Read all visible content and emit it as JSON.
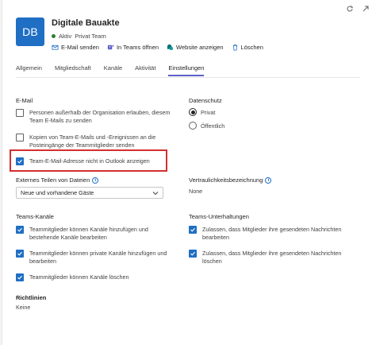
{
  "header": {
    "avatar_initials": "DB",
    "title": "Digitale Bauakte",
    "status": "Aktiv",
    "privacy": "Privat Team",
    "actions": [
      {
        "label": "E-Mail senden",
        "icon": "mail-icon"
      },
      {
        "label": "In Teams öffnen",
        "icon": "teams-icon"
      },
      {
        "label": "Website anzeigen",
        "icon": "sharepoint-icon"
      },
      {
        "label": "Löschen",
        "icon": "trash-icon"
      }
    ]
  },
  "tabs": [
    "Allgemein",
    "Mitgliedschaft",
    "Kanäle",
    "Aktivität",
    "Einstellungen"
  ],
  "active_tab": "Einstellungen",
  "email": {
    "heading": "E-Mail",
    "options": [
      {
        "label_line1": "Personen außerhalb der Organisation erlauben, diesem",
        "label_line2": "Team E-Mails zu senden",
        "checked": false
      },
      {
        "label_line1": "Kopien von Team-E-Mails und -Ereignissen an die",
        "label_line2": "Posteingänge der Teammitglieder senden",
        "checked": false
      },
      {
        "label_line1": "Team-E-Mail-Adresse nicht in Outlook anzeigen",
        "label_line2": "",
        "checked": true
      }
    ]
  },
  "privacy_section": {
    "heading": "Datenschutz",
    "options": [
      "Privat",
      "Öffentlich"
    ],
    "selected": "Privat"
  },
  "external_sharing": {
    "heading": "Externes Teilen von Dateien",
    "value": "Neue und vorhandene Gäste"
  },
  "sensitivity": {
    "heading": "Vertraulichkeitsbezeichnung",
    "value": "None"
  },
  "teams_channels": {
    "heading": "Teams-Kanäle",
    "options": [
      {
        "label_line1": "Teammitglieder können Kanäle hinzufügen und",
        "label_line2": "bestehende Kanäle bearbeiten",
        "checked": true
      },
      {
        "label_line1": "Teammitglieder können private Kanäle hinzufügen und",
        "label_line2": "bearbeiten",
        "checked": true
      },
      {
        "label_line1": "Teammitglieder können Kanäle löschen",
        "label_line2": "",
        "checked": true
      }
    ]
  },
  "teams_conversations": {
    "heading": "Teams-Unterhaltungen",
    "options": [
      {
        "label_line1": "Zulassen, dass Mitglieder ihre gesendeten Nachrichten",
        "label_line2": "bearbeiten",
        "checked": true
      },
      {
        "label_line1": "Zulassen, dass Mitglieder ihre gesendeten Nachrichten",
        "label_line2": "löschen",
        "checked": true
      }
    ]
  },
  "policies": {
    "heading": "Richtlinien",
    "value": "Keine"
  },
  "colors": {
    "accent": "#1f6fc4",
    "tab_underline": "#5b5fc7",
    "highlight": "#d32f2f",
    "status_green": "#2e7d32"
  }
}
